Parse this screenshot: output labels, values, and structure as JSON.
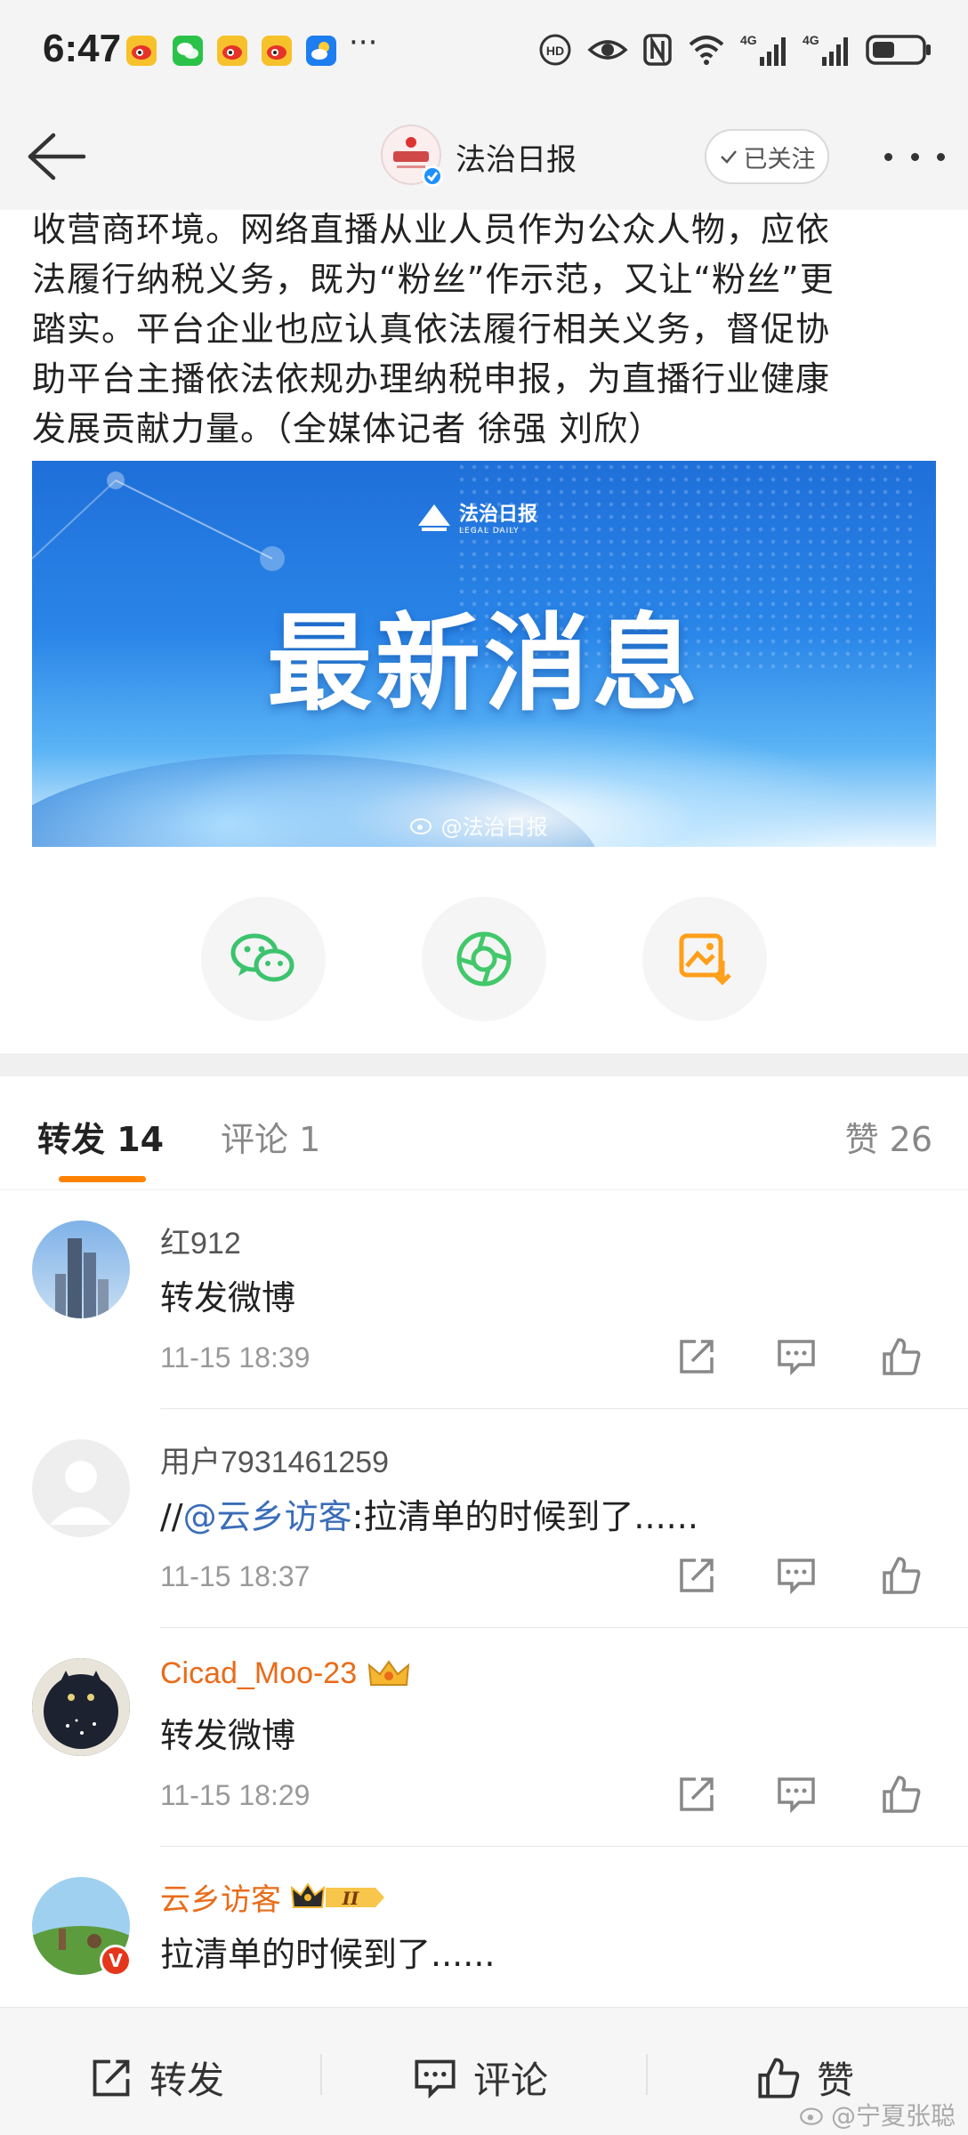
{
  "status_bar": {
    "time": "6:47",
    "overflow_dots": "···",
    "network_1": "4G",
    "network_2": "4G"
  },
  "nav": {
    "title": "法治日报",
    "follow_label": "已关注"
  },
  "article": {
    "lines": [
      "收营商环境。网络直播从业人员作为公众人物，应依",
      "法履行纳税义务，既为“粉丝”作示范，又让“粉丝”更",
      "踏实。平台企业也应认真依法履行相关义务，督促协",
      "助平台主播依法依规办理纳税申报，为直播行业健康",
      "发展贡献力量。（全媒体记者 徐强 刘欣）"
    ]
  },
  "banner": {
    "logo_name": "法治日报",
    "logo_sub": "LEGAL DAILY",
    "headline": "最新消息",
    "watermark": "@法治日报"
  },
  "share": {
    "icons": [
      "wechat-icon",
      "moments-icon",
      "save-image-icon"
    ]
  },
  "tabs": {
    "repost": "转发 14",
    "comments": "评论 1",
    "likes": "赞 26"
  },
  "comments": [
    {
      "name": "红912",
      "text": "转发微博",
      "mention": "",
      "time": "11-15 18:39",
      "badge": ""
    },
    {
      "name": "用户7931461259",
      "text": ":拉清单的时候到了......",
      "prefix": "//",
      "mention": "@云乡访客",
      "time": "11-15 18:37",
      "badge": ""
    },
    {
      "name": "Cicad_Moo-23",
      "text": "转发微博",
      "mention": "",
      "time": "11-15 18:29",
      "badge": "crown"
    },
    {
      "name": "云乡访客",
      "text": "拉清单的时候到了......",
      "mention": "",
      "time": "",
      "badge": "vip-ii",
      "badge_text": "II"
    }
  ],
  "bottom_bar": {
    "repost": "转发",
    "comment": "评论",
    "like": "赞",
    "watermark": "@宁夏张聪"
  },
  "colors": {
    "accent": "#ff8200",
    "link": "#3b6db8",
    "vip_name": "#e86c1a",
    "wechat": "#3cc36e",
    "moments": "#42c86a",
    "save": "#ff9f1a"
  }
}
